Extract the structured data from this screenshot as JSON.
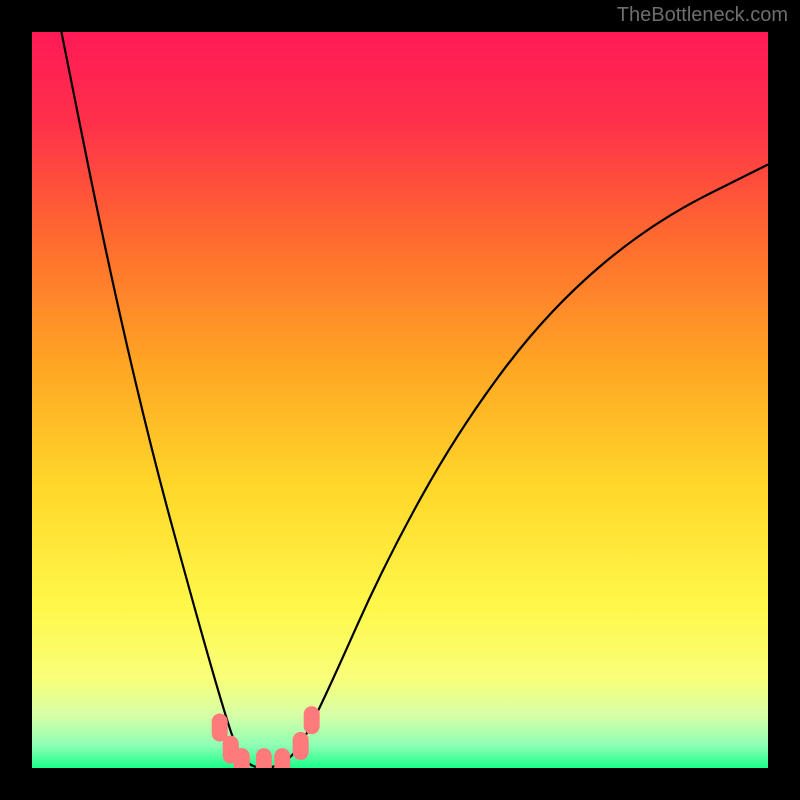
{
  "watermark": "TheBottleneck.com",
  "chart_data": {
    "type": "line",
    "title": "",
    "xlabel": "",
    "ylabel": "",
    "xlim": [
      0,
      100
    ],
    "ylim": [
      0,
      100
    ],
    "background": {
      "type": "vertical-gradient",
      "stops": [
        {
          "offset": 0.0,
          "color": "#ff1a56"
        },
        {
          "offset": 0.12,
          "color": "#ff2f4a"
        },
        {
          "offset": 0.28,
          "color": "#ff6a2f"
        },
        {
          "offset": 0.45,
          "color": "#ffa524"
        },
        {
          "offset": 0.62,
          "color": "#ffd82a"
        },
        {
          "offset": 0.78,
          "color": "#fff84a"
        },
        {
          "offset": 0.88,
          "color": "#f8ff7a"
        },
        {
          "offset": 0.93,
          "color": "#d4ffa8"
        },
        {
          "offset": 0.97,
          "color": "#8cffb4"
        },
        {
          "offset": 1.0,
          "color": "#1aff88"
        }
      ]
    },
    "series": [
      {
        "name": "bottleneck-curve",
        "color": "#000000",
        "approx_points": [
          {
            "x": 4,
            "y": 100
          },
          {
            "x": 10,
            "y": 70
          },
          {
            "x": 16,
            "y": 44
          },
          {
            "x": 22,
            "y": 22
          },
          {
            "x": 26,
            "y": 8
          },
          {
            "x": 28,
            "y": 2
          },
          {
            "x": 30,
            "y": 0
          },
          {
            "x": 33,
            "y": 0
          },
          {
            "x": 36,
            "y": 2
          },
          {
            "x": 40,
            "y": 10
          },
          {
            "x": 48,
            "y": 28
          },
          {
            "x": 58,
            "y": 46
          },
          {
            "x": 70,
            "y": 62
          },
          {
            "x": 84,
            "y": 74
          },
          {
            "x": 100,
            "y": 82
          }
        ]
      }
    ],
    "markers": [
      {
        "x": 25.5,
        "y": 5.5,
        "color": "#ff7a7a"
      },
      {
        "x": 27.0,
        "y": 2.5,
        "color": "#ff7a7a"
      },
      {
        "x": 28.5,
        "y": 0.8,
        "color": "#ff7a7a"
      },
      {
        "x": 31.5,
        "y": 0.8,
        "color": "#ff7a7a"
      },
      {
        "x": 34.0,
        "y": 0.8,
        "color": "#ff7a7a"
      },
      {
        "x": 36.5,
        "y": 3.0,
        "color": "#ff7a7a"
      },
      {
        "x": 38.0,
        "y": 6.5,
        "color": "#ff7a7a"
      }
    ]
  }
}
